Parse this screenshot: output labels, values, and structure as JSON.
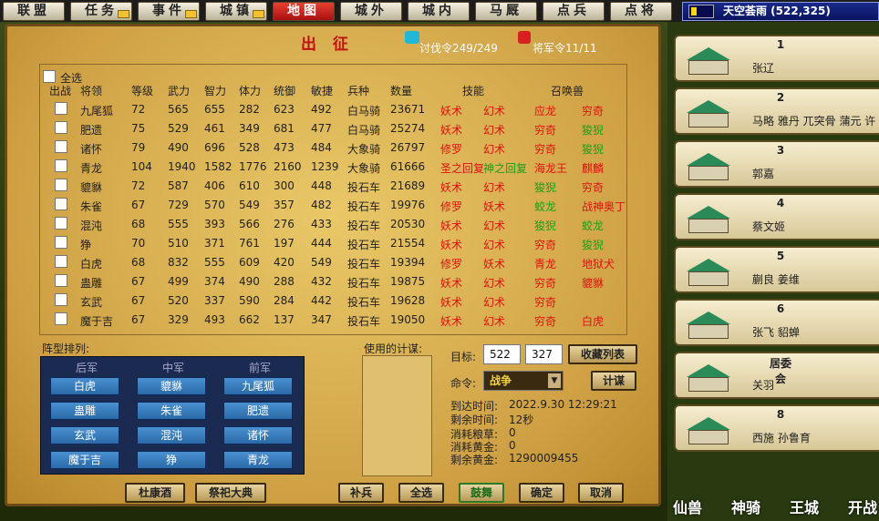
{
  "tabs": [
    {
      "label": "联盟",
      "env": false
    },
    {
      "label": "任务",
      "env": true
    },
    {
      "label": "事件",
      "env": true
    },
    {
      "label": "城镇",
      "env": true
    },
    {
      "label": "地图",
      "env": false,
      "active": true
    },
    {
      "label": "城外",
      "env": false
    },
    {
      "label": "城内",
      "env": false
    },
    {
      "label": "马厩",
      "env": false
    },
    {
      "label": "点兵",
      "env": false
    },
    {
      "label": "点将",
      "env": false
    }
  ],
  "user": {
    "name": "天空荟雨 (522,325)"
  },
  "panel": {
    "title": "出 征",
    "attack_orders": "讨伐令249/249",
    "general_orders": "将军令11/11"
  },
  "troops": {
    "select_all": "全选",
    "headers": [
      "出战",
      "将领",
      "等级",
      "武力",
      "智力",
      "体力",
      "统御",
      "敏捷",
      "兵种",
      "数量",
      "技能",
      "召唤兽"
    ],
    "rows": [
      {
        "name": "九尾狐",
        "level": "72",
        "force": "565",
        "intel": "655",
        "hp": "282",
        "command": "623",
        "agility": "492",
        "unit": "白马骑",
        "count": "23671",
        "skill1": "妖术",
        "skill2": "幻术",
        "beast1": "应龙",
        "beast2": "穷奇"
      },
      {
        "name": "肥遗",
        "level": "75",
        "force": "529",
        "intel": "461",
        "hp": "349",
        "command": "681",
        "agility": "477",
        "unit": "白马骑",
        "count": "25274",
        "skill1": "妖术",
        "skill2": "幻术",
        "beast1": "穷奇",
        "beast2": "狻猊"
      },
      {
        "name": "诸怀",
        "level": "79",
        "force": "490",
        "intel": "696",
        "hp": "528",
        "command": "473",
        "agility": "484",
        "unit": "大象骑",
        "count": "26797",
        "skill1": "修罗",
        "skill2": "幻术",
        "beast1": "穷奇",
        "beast2": "狻猊"
      },
      {
        "name": "青龙",
        "level": "104",
        "force": "1940",
        "intel": "1582",
        "hp": "1776",
        "command": "2160",
        "agility": "1239",
        "unit": "大象骑",
        "count": "61666",
        "skill1": "圣之回复",
        "skill2": "神之回复",
        "beast1": "海龙王",
        "beast2": "麒麟"
      },
      {
        "name": "貔貅",
        "level": "72",
        "force": "587",
        "intel": "406",
        "hp": "610",
        "command": "300",
        "agility": "448",
        "unit": "投石车",
        "count": "21689",
        "skill1": "妖术",
        "skill2": "幻术",
        "beast1": "狻猊",
        "beast2": "穷奇"
      },
      {
        "name": "朱雀",
        "level": "67",
        "force": "729",
        "intel": "570",
        "hp": "549",
        "command": "357",
        "agility": "482",
        "unit": "投石车",
        "count": "19976",
        "skill1": "修罗",
        "skill2": "妖术",
        "beast1": "蛟龙",
        "beast2": "战神奥丁"
      },
      {
        "name": "混沌",
        "level": "68",
        "force": "555",
        "intel": "393",
        "hp": "566",
        "command": "276",
        "agility": "433",
        "unit": "投石车",
        "count": "20530",
        "skill1": "妖术",
        "skill2": "幻术",
        "beast1": "狻猊",
        "beast2": "蛟龙"
      },
      {
        "name": "狰",
        "level": "70",
        "force": "510",
        "intel": "371",
        "hp": "761",
        "command": "197",
        "agility": "444",
        "unit": "投石车",
        "count": "21554",
        "skill1": "妖术",
        "skill2": "幻术",
        "beast1": "穷奇",
        "beast2": "狻猊"
      },
      {
        "name": "白虎",
        "level": "68",
        "force": "832",
        "intel": "555",
        "hp": "609",
        "command": "420",
        "agility": "549",
        "unit": "投石车",
        "count": "19394",
        "skill1": "修罗",
        "skill2": "妖术",
        "beast1": "青龙",
        "beast2": "地狱犬"
      },
      {
        "name": "蛊雕",
        "level": "67",
        "force": "499",
        "intel": "374",
        "hp": "490",
        "command": "288",
        "agility": "432",
        "unit": "投石车",
        "count": "19875",
        "skill1": "妖术",
        "skill2": "幻术",
        "beast1": "穷奇",
        "beast2": "貔貅"
      },
      {
        "name": "玄武",
        "level": "67",
        "force": "520",
        "intel": "337",
        "hp": "590",
        "command": "284",
        "agility": "442",
        "unit": "投石车",
        "count": "19628",
        "skill1": "妖术",
        "skill2": "幻术",
        "beast1": "穷奇",
        "beast2": ""
      },
      {
        "name": "魔于吉",
        "level": "67",
        "force": "329",
        "intel": "493",
        "hp": "662",
        "command": "137",
        "agility": "347",
        "unit": "投石车",
        "count": "19050",
        "skill1": "妖术",
        "skill2": "幻术",
        "beast1": "穷奇",
        "beast2": "白虎"
      }
    ]
  },
  "formation": {
    "label": "阵型排列:",
    "headers": [
      "后军",
      "中军",
      "前军"
    ],
    "grid": [
      [
        "白虎",
        "貔貅",
        "九尾狐"
      ],
      [
        "蛊雕",
        "朱雀",
        "肥遗"
      ],
      [
        "玄武",
        "混沌",
        "诸怀"
      ],
      [
        "魔于吉",
        "狰",
        "青龙"
      ]
    ]
  },
  "plans": {
    "label": "使用的计谋:"
  },
  "target": {
    "label": "目标:",
    "x": "522",
    "y": "327",
    "collect_btn": "收藏列表"
  },
  "command": {
    "label": "命令:",
    "value": "战争",
    "plan_btn": "计谋"
  },
  "status": {
    "arrive_label": "到达时间:",
    "arrive": "2022.9.30  12:29:21",
    "remain_label": "剩余时间:",
    "remain": "12秒",
    "food_label": "消耗粮草:",
    "food": "0",
    "gold_label": "消耗黄金:",
    "gold": "0",
    "left_label": "剩余黄金:",
    "left": "1290009455"
  },
  "buttons": {
    "dukang": "杜康酒",
    "sacrifice": "祭祀大典",
    "reinforce": "补兵",
    "selectall": "全选",
    "drum": "鼓舞",
    "confirm": "确定",
    "cancel": "取消"
  },
  "right": [
    {
      "num": "1",
      "names": "张辽"
    },
    {
      "num": "2",
      "names": "马略 雅丹 兀突骨 蒲元 许"
    },
    {
      "num": "3",
      "names": "郭嘉"
    },
    {
      "num": "4",
      "names": "蔡文姬"
    },
    {
      "num": "5",
      "names": "蒯良 姜维"
    },
    {
      "num": "6",
      "names": "张飞 貂蝉"
    },
    {
      "num": "居委会",
      "names": "关羽"
    },
    {
      "num": "8",
      "names": "西施 孙鲁育"
    }
  ],
  "bottom": {
    "a": "仙兽",
    "b": "神骑",
    "c": "王城",
    "d": "开战"
  },
  "colors": {
    "accent_red": "#e01010",
    "skill_green": "#18a018",
    "formation_blue": "#2a6aa8"
  }
}
